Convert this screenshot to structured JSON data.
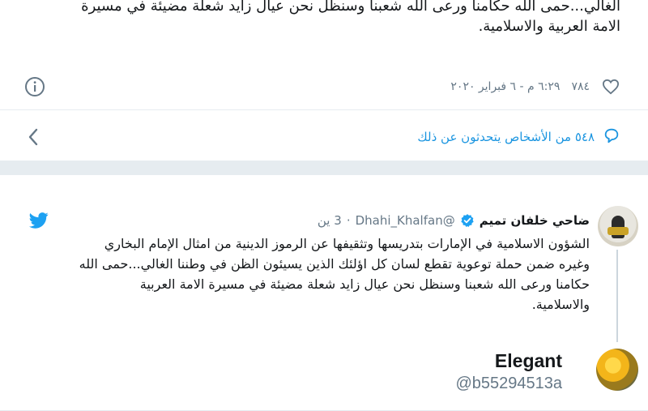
{
  "colors": {
    "background": "#e6ecf0",
    "accent": "#1da1f2",
    "link": "#1b95e0",
    "muted": "#657786",
    "text": "#14171a"
  },
  "top_tweet": {
    "text_lines": [
      "الغالي...حمى الله حكامنا ورعى الله شعبنا وسنظل نحن عيال زايد شعلة مضيئة في مسيرة",
      "الامة العربية والاسلامية."
    ],
    "likes": "٧٨٤",
    "timestamp": "٦:٢٩ م - ٦ فبراير ٢٠٢٠",
    "icons": {
      "like": "heart-icon",
      "info": "info-icon"
    }
  },
  "conversation": {
    "text": "٥٤٨ من الأشخاص يتحدثون عن ذلك",
    "icons": {
      "reply": "reply-bubble-icon",
      "open": "chevron-left-icon"
    }
  },
  "embedded_tweet": {
    "name": "ضاحي خلفان تميم",
    "handle": "@Dhahi_Khalfan",
    "separator": "·",
    "time": "3 ين",
    "verified": true,
    "text_lines": [
      "الشؤون الاسلامية في الإمارات بتدريسها وتثقيفها عن الرموز الدينية من امثال الإمام البخاري",
      "وغيره ضمن حملة توعوية تقطع لسان كل اؤلئك الذين يسيئون الظن في وطننا الغالي...حمى الله",
      "حكامنا ورعى الله شعبنا وسنظل نحن عيال زايد شعلة مضيئة في مسيرة الامة العربية",
      "والاسلامية."
    ],
    "icons": {
      "brand": "twitter-bird-icon",
      "verified": "verified-badge-icon",
      "avatar": "avatar-icon"
    }
  },
  "reply_user": {
    "name": "Elegant",
    "handle": "@b55294513a"
  }
}
